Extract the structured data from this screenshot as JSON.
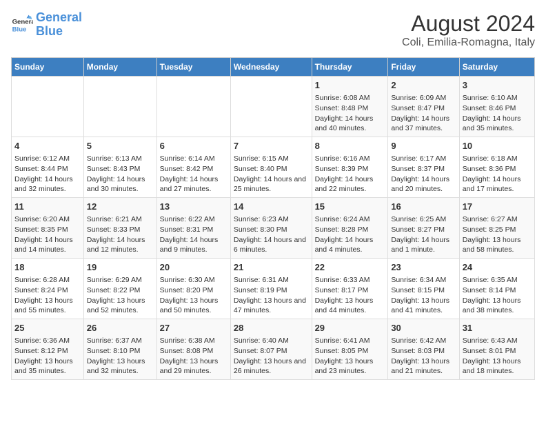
{
  "header": {
    "logo_general": "General",
    "logo_blue": "Blue",
    "month_year": "August 2024",
    "location": "Coli, Emilia-Romagna, Italy"
  },
  "weekdays": [
    "Sunday",
    "Monday",
    "Tuesday",
    "Wednesday",
    "Thursday",
    "Friday",
    "Saturday"
  ],
  "weeks": [
    [
      {
        "day": "",
        "info": ""
      },
      {
        "day": "",
        "info": ""
      },
      {
        "day": "",
        "info": ""
      },
      {
        "day": "",
        "info": ""
      },
      {
        "day": "1",
        "info": "Sunrise: 6:08 AM\nSunset: 8:48 PM\nDaylight: 14 hours and 40 minutes."
      },
      {
        "day": "2",
        "info": "Sunrise: 6:09 AM\nSunset: 8:47 PM\nDaylight: 14 hours and 37 minutes."
      },
      {
        "day": "3",
        "info": "Sunrise: 6:10 AM\nSunset: 8:46 PM\nDaylight: 14 hours and 35 minutes."
      }
    ],
    [
      {
        "day": "4",
        "info": "Sunrise: 6:12 AM\nSunset: 8:44 PM\nDaylight: 14 hours and 32 minutes."
      },
      {
        "day": "5",
        "info": "Sunrise: 6:13 AM\nSunset: 8:43 PM\nDaylight: 14 hours and 30 minutes."
      },
      {
        "day": "6",
        "info": "Sunrise: 6:14 AM\nSunset: 8:42 PM\nDaylight: 14 hours and 27 minutes."
      },
      {
        "day": "7",
        "info": "Sunrise: 6:15 AM\nSunset: 8:40 PM\nDaylight: 14 hours and 25 minutes."
      },
      {
        "day": "8",
        "info": "Sunrise: 6:16 AM\nSunset: 8:39 PM\nDaylight: 14 hours and 22 minutes."
      },
      {
        "day": "9",
        "info": "Sunrise: 6:17 AM\nSunset: 8:37 PM\nDaylight: 14 hours and 20 minutes."
      },
      {
        "day": "10",
        "info": "Sunrise: 6:18 AM\nSunset: 8:36 PM\nDaylight: 14 hours and 17 minutes."
      }
    ],
    [
      {
        "day": "11",
        "info": "Sunrise: 6:20 AM\nSunset: 8:35 PM\nDaylight: 14 hours and 14 minutes."
      },
      {
        "day": "12",
        "info": "Sunrise: 6:21 AM\nSunset: 8:33 PM\nDaylight: 14 hours and 12 minutes."
      },
      {
        "day": "13",
        "info": "Sunrise: 6:22 AM\nSunset: 8:31 PM\nDaylight: 14 hours and 9 minutes."
      },
      {
        "day": "14",
        "info": "Sunrise: 6:23 AM\nSunset: 8:30 PM\nDaylight: 14 hours and 6 minutes."
      },
      {
        "day": "15",
        "info": "Sunrise: 6:24 AM\nSunset: 8:28 PM\nDaylight: 14 hours and 4 minutes."
      },
      {
        "day": "16",
        "info": "Sunrise: 6:25 AM\nSunset: 8:27 PM\nDaylight: 14 hours and 1 minute."
      },
      {
        "day": "17",
        "info": "Sunrise: 6:27 AM\nSunset: 8:25 PM\nDaylight: 13 hours and 58 minutes."
      }
    ],
    [
      {
        "day": "18",
        "info": "Sunrise: 6:28 AM\nSunset: 8:24 PM\nDaylight: 13 hours and 55 minutes."
      },
      {
        "day": "19",
        "info": "Sunrise: 6:29 AM\nSunset: 8:22 PM\nDaylight: 13 hours and 52 minutes."
      },
      {
        "day": "20",
        "info": "Sunrise: 6:30 AM\nSunset: 8:20 PM\nDaylight: 13 hours and 50 minutes."
      },
      {
        "day": "21",
        "info": "Sunrise: 6:31 AM\nSunset: 8:19 PM\nDaylight: 13 hours and 47 minutes."
      },
      {
        "day": "22",
        "info": "Sunrise: 6:33 AM\nSunset: 8:17 PM\nDaylight: 13 hours and 44 minutes."
      },
      {
        "day": "23",
        "info": "Sunrise: 6:34 AM\nSunset: 8:15 PM\nDaylight: 13 hours and 41 minutes."
      },
      {
        "day": "24",
        "info": "Sunrise: 6:35 AM\nSunset: 8:14 PM\nDaylight: 13 hours and 38 minutes."
      }
    ],
    [
      {
        "day": "25",
        "info": "Sunrise: 6:36 AM\nSunset: 8:12 PM\nDaylight: 13 hours and 35 minutes."
      },
      {
        "day": "26",
        "info": "Sunrise: 6:37 AM\nSunset: 8:10 PM\nDaylight: 13 hours and 32 minutes."
      },
      {
        "day": "27",
        "info": "Sunrise: 6:38 AM\nSunset: 8:08 PM\nDaylight: 13 hours and 29 minutes."
      },
      {
        "day": "28",
        "info": "Sunrise: 6:40 AM\nSunset: 8:07 PM\nDaylight: 13 hours and 26 minutes."
      },
      {
        "day": "29",
        "info": "Sunrise: 6:41 AM\nSunset: 8:05 PM\nDaylight: 13 hours and 23 minutes."
      },
      {
        "day": "30",
        "info": "Sunrise: 6:42 AM\nSunset: 8:03 PM\nDaylight: 13 hours and 21 minutes."
      },
      {
        "day": "31",
        "info": "Sunrise: 6:43 AM\nSunset: 8:01 PM\nDaylight: 13 hours and 18 minutes."
      }
    ]
  ]
}
